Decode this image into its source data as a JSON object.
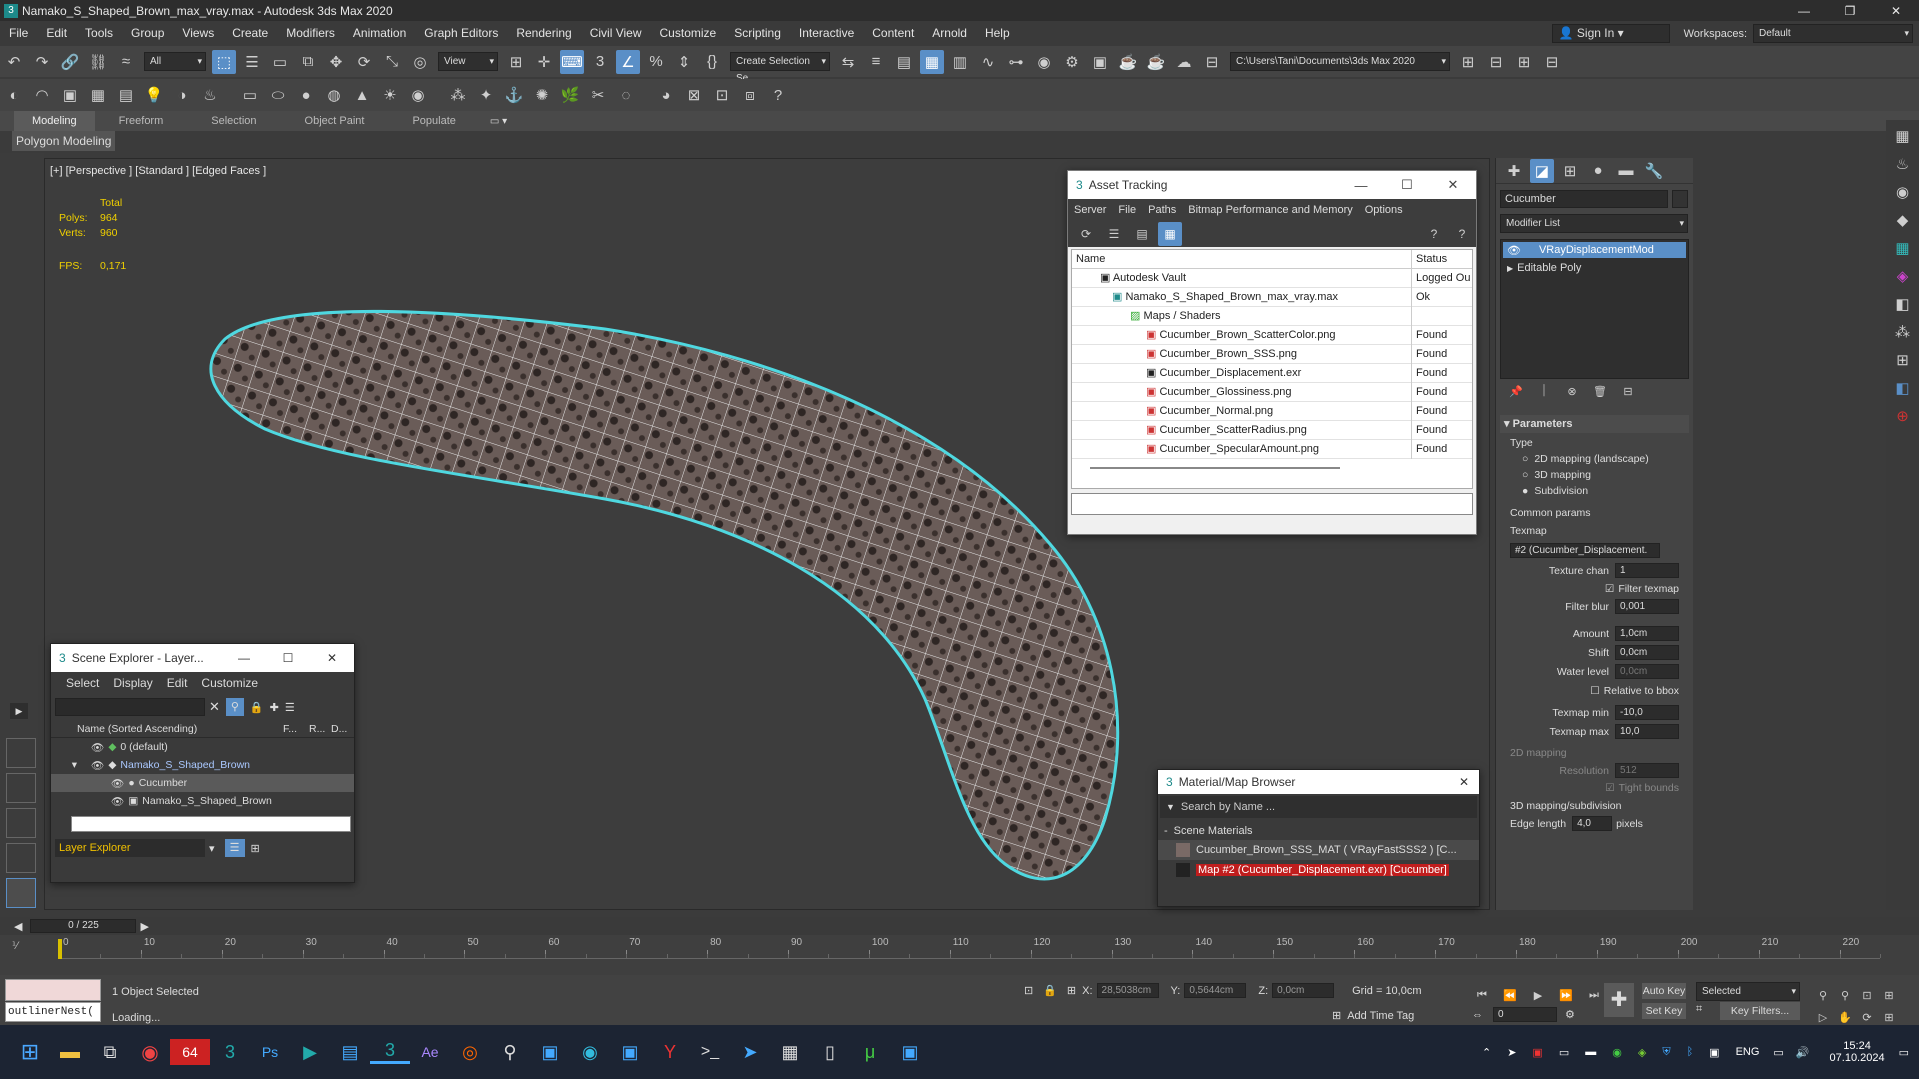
{
  "app": {
    "title": "Namako_S_Shaped_Brown_max_vray.max - Autodesk 3ds Max 2020",
    "workspaces_label": "Workspaces:",
    "workspace": "Default",
    "sign_in": "Sign In"
  },
  "menu": [
    "File",
    "Edit",
    "Tools",
    "Group",
    "Views",
    "Create",
    "Modifiers",
    "Animation",
    "Graph Editors",
    "Rendering",
    "Civil View",
    "Customize",
    "Scripting",
    "Interactive",
    "Content",
    "Arnold",
    "Help"
  ],
  "toolbar": {
    "selection_filter": "All",
    "ref_coord": "View",
    "named_selection": "Create Selection Se",
    "project_path": "C:\\Users\\Tani\\Documents\\3ds Max 2020"
  },
  "ribbon": {
    "tabs": [
      "Modeling",
      "Freeform",
      "Selection",
      "Object Paint",
      "Populate"
    ],
    "subtitle": "Polygon Modeling"
  },
  "viewport": {
    "label": "[+] [Perspective ] [Standard ] [Edged Faces ]",
    "stats_total": "Total",
    "polys_label": "Polys:",
    "polys": "964",
    "verts_label": "Verts:",
    "verts": "960",
    "fps_label": "FPS:",
    "fps": "0,171"
  },
  "asset_tracking": {
    "title": "Asset Tracking",
    "menu": [
      "Server",
      "File",
      "Paths",
      "Bitmap Performance and Memory",
      "Options"
    ],
    "col_name": "Name",
    "col_status": "Status",
    "rows": [
      {
        "name": "Autodesk Vault",
        "status": "Logged Ou"
      },
      {
        "name": "Namako_S_Shaped_Brown_max_vray.max",
        "status": "Ok"
      },
      {
        "name": "Maps / Shaders",
        "status": ""
      },
      {
        "name": "Cucumber_Brown_ScatterColor.png",
        "status": "Found"
      },
      {
        "name": "Cucumber_Brown_SSS.png",
        "status": "Found"
      },
      {
        "name": "Cucumber_Displacement.exr",
        "status": "Found"
      },
      {
        "name": "Cucumber_Glossiness.png",
        "status": "Found"
      },
      {
        "name": "Cucumber_Normal.png",
        "status": "Found"
      },
      {
        "name": "Cucumber_ScatterRadius.png",
        "status": "Found"
      },
      {
        "name": "Cucumber_SpecularAmount.png",
        "status": "Found"
      }
    ]
  },
  "scene_explorer": {
    "title": "Scene Explorer - Layer...",
    "menu": [
      "Select",
      "Display",
      "Edit",
      "Customize"
    ],
    "col_name": "Name (Sorted Ascending)",
    "col_f": "F...",
    "col_r": "R...",
    "col_d": "D...",
    "rows": [
      {
        "name": "0 (default)"
      },
      {
        "name": "Namako_S_Shaped_Brown"
      },
      {
        "name": "Cucumber"
      },
      {
        "name": "Namako_S_Shaped_Brown"
      }
    ],
    "footer": "Layer Explorer"
  },
  "material_browser": {
    "title": "Material/Map Browser",
    "search": "Search by Name ...",
    "section": "Scene Materials",
    "items": [
      "Cucumber_Brown_SSS_MAT  ( VRayFastSSS2 )  [C...",
      "Map #2 (Cucumber_Displacement.exr)  [Cucumber]"
    ]
  },
  "command_panel": {
    "object_name": "Cucumber",
    "modifier_list": "Modifier List",
    "stack": [
      "VRayDisplacementMod",
      "Editable Poly"
    ],
    "rollout": "Parameters",
    "type_label": "Type",
    "types": [
      "2D mapping (landscape)",
      "3D mapping",
      "Subdivision"
    ],
    "common_params": "Common params",
    "texmap_label": "Texmap",
    "texmap": "#2 (Cucumber_Displacement.",
    "texture_chan_label": "Texture chan",
    "texture_chan": "1",
    "filter_texmap": "Filter texmap",
    "filter_blur_label": "Filter blur",
    "filter_blur": "0,001",
    "amount_label": "Amount",
    "amount": "1,0cm",
    "shift_label": "Shift",
    "shift": "0,0cm",
    "water_label": "Water level",
    "water": "0,0cm",
    "relative": "Relative to bbox",
    "texmap_min_label": "Texmap min",
    "texmap_min": "-10,0",
    "texmap_max_label": "Texmap max",
    "texmap_max": "10,0",
    "mapping2d": "2D mapping",
    "resolution_label": "Resolution",
    "resolution": "512",
    "tight_bounds": "Tight bounds",
    "mapping3d": "3D mapping/subdivision",
    "edge_length_label": "Edge length",
    "edge_length": "4,0",
    "pixels": "pixels"
  },
  "timeline": {
    "frame": "0 / 225",
    "ticks": [
      "0",
      "10",
      "20",
      "30",
      "40",
      "50",
      "60",
      "70",
      "80",
      "90",
      "100",
      "110",
      "120",
      "130",
      "140",
      "150",
      "160",
      "170",
      "180",
      "190",
      "200",
      "210",
      "220"
    ]
  },
  "status": {
    "selected": "1 Object Selected",
    "loading": "Loading...",
    "script": "outlinerNest(",
    "x_label": "X:",
    "x": "28,5038cm",
    "y_label": "Y:",
    "y": "0,5644cm",
    "z_label": "Z:",
    "z": "0,0cm",
    "grid": "Grid = 10,0cm",
    "add_time_tag": "Add Time Tag",
    "auto_key": "Auto Key",
    "set_key": "Set Key",
    "selected_dd": "Selected",
    "key_filters": "Key Filters...",
    "frame_field": "0"
  },
  "taskbar": {
    "lang": "ENG",
    "time": "15:24",
    "date": "07.10.2024"
  },
  "colors": {
    "accent": "#5a8fc7",
    "wire": "#4fd8e0"
  }
}
